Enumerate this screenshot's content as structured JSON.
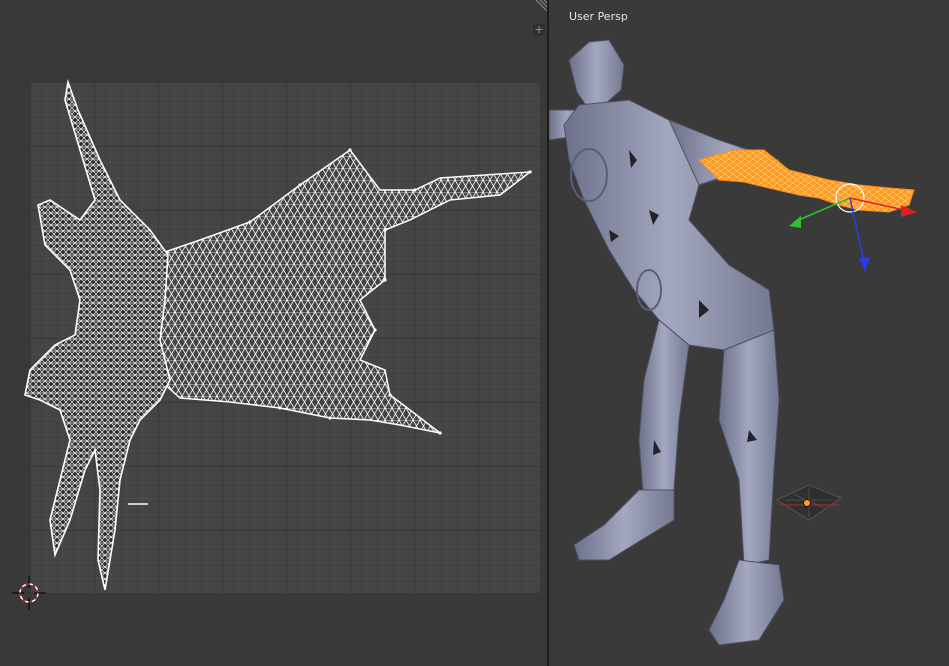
{
  "uv_editor": {
    "area_actions": [
      "+",
      "+"
    ]
  },
  "viewport": {
    "view_label": "User Persp"
  },
  "colors": {
    "background": "#393939",
    "uv_grid": "#444444",
    "mesh_wire": "#ffffff",
    "body_mesh": "#8e93ad",
    "selection": "#ff8c1a",
    "gizmo_x": "#e02020",
    "gizmo_y": "#30c030",
    "gizmo_z": "#2a3de0"
  },
  "icons": [
    "2d-cursor-icon",
    "split-corner-icon",
    "lamp-icon",
    "manipulator-gizmo-icon"
  ]
}
